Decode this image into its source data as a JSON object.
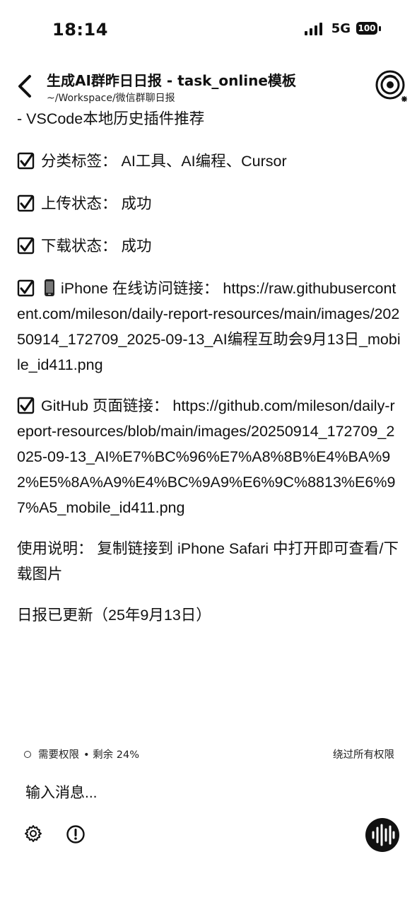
{
  "status_bar": {
    "time": "18:14",
    "network": "5G",
    "battery": "100",
    "signal_icon": "signal-bars-icon",
    "battery_icon": "battery-icon"
  },
  "header": {
    "title": "生成AI群昨日日报 - task_online模板",
    "subtitle": "~/Workspace/微信群聊日报",
    "back_icon": "chevron-left-icon",
    "avatar_icon": "agent-avatar-icon"
  },
  "content": {
    "line_plugin": "- VSCode本地历史插件推荐",
    "tags": {
      "label": "分类标签：",
      "value": "AI工具、AI编程、Cursor"
    },
    "upload": {
      "label": "上传状态：",
      "value": "成功"
    },
    "download": {
      "label": "下载状态：",
      "value": "成功"
    },
    "iphone_link": {
      "label": "iPhone 在线访问链接：",
      "value": "https://raw.githubusercontent.com/mileson/daily-report-resources/main/images/20250914_172709_2025-09-13_AI编程互助会9月13日_mobile_id411.png"
    },
    "github_link": {
      "label": "GitHub 页面链接：",
      "value": "https://github.com/mileson/daily-report-resources/blob/main/images/20250914_172709_2025-09-13_AI%E7%BC%96%E7%A8%8B%E4%BA%92%E5%8A%A9%E4%BC%9A9%E6%9C%8813%E6%97%A5_mobile_id411.png"
    },
    "usage": {
      "label": "使用说明：",
      "value": "复制链接到 iPhone Safari 中打开即可查看/下载图片"
    },
    "footer_note": "日报已更新（25年9月13日）"
  },
  "permissions": {
    "need_label": "需要权限",
    "remaining": "• 剩余 24%",
    "bypass": "绕过所有权限"
  },
  "composer": {
    "placeholder": "输入消息...",
    "value": ""
  },
  "icons": {
    "check": "checkbox-checked-icon",
    "phone": "mobile-phone-icon",
    "settings": "gear-icon",
    "alert": "alert-circle-icon",
    "voice": "voice-waveform-icon"
  }
}
